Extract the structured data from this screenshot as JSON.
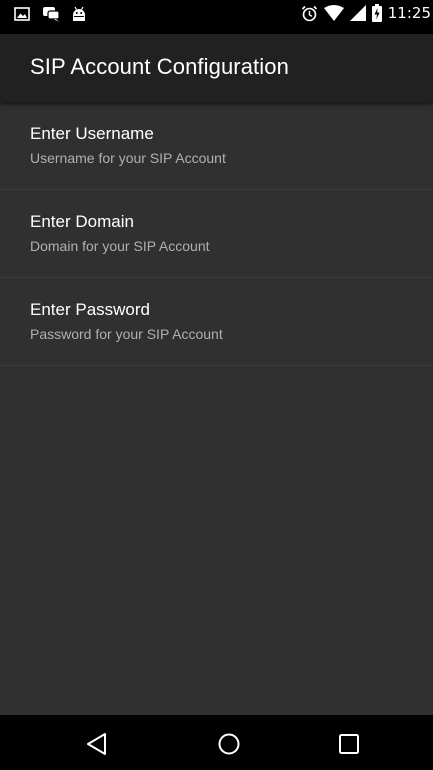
{
  "status_bar": {
    "time": "11:25",
    "icons_left": [
      "image-notification-icon",
      "chat-notification-icon",
      "android-debug-icon"
    ],
    "icons_right": [
      "alarm-icon",
      "wifi-icon",
      "cell-signal-icon",
      "battery-charging-icon"
    ]
  },
  "app_bar": {
    "title": "SIP Account Configuration"
  },
  "preferences": [
    {
      "title": "Enter Username",
      "summary": "Username for your SIP Account"
    },
    {
      "title": "Enter Domain",
      "summary": "Domain for your SIP Account"
    },
    {
      "title": "Enter Password",
      "summary": "Password for your SIP Account"
    }
  ],
  "nav_bar": {
    "buttons": [
      "back-icon",
      "home-icon",
      "recents-icon"
    ]
  },
  "colors": {
    "status_bar": "#000000",
    "app_bar": "#212121",
    "content_bg": "#303030",
    "divider": "#3d3d3d",
    "summary_text": "#b0b0b0"
  }
}
